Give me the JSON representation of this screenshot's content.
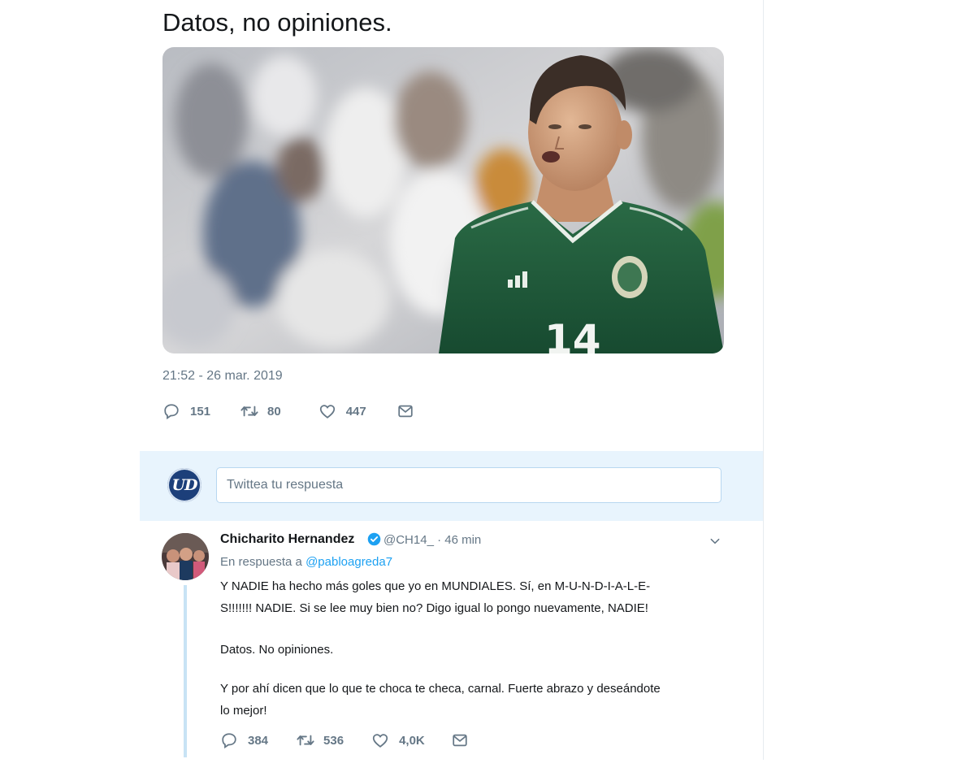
{
  "tweet": {
    "text": "Datos, no opiniones.",
    "timestamp": "21:52 - 26 mar. 2019",
    "actions": {
      "replies": "151",
      "retweets": "80",
      "likes": "447"
    },
    "image": {
      "jersey_number": "14"
    }
  },
  "reply_box": {
    "logo_text": "UD",
    "placeholder": "Twittea tu respuesta"
  },
  "reply_tweet": {
    "author_name": "Chicharito Hernandez",
    "handle_time": "@CH14_ · 46 min",
    "in_reply_prefix": "En respuesta a ",
    "in_reply_handle": "@pabloagreda7",
    "paragraph1_line1": "Y NADIE ha hecho más goles que yo en MUNDIALES. Sí, en M-U-N-D-I-A-L-E-",
    "paragraph1_line2": "S!!!!!!! NADIE. Si se lee muy bien no? Digo igual lo pongo nuevamente, NADIE!",
    "paragraph2": "Datos. No opiniones.",
    "paragraph3_line1": "Y por ahí dicen que lo que te choca te checa, carnal. Fuerte abrazo y deseándote",
    "paragraph3_line2": "lo mejor!",
    "actions": {
      "replies": "384",
      "retweets": "536",
      "likes": "4,0K"
    }
  },
  "colors": {
    "accent": "#1da1f2",
    "muted": "#657786",
    "reply_bg": "#e8f4fd",
    "jersey_green": "#1f5a3a"
  },
  "icons": [
    "reply-icon",
    "retweet-icon",
    "like-icon",
    "message-icon",
    "verified-icon",
    "chevron-down-icon"
  ]
}
